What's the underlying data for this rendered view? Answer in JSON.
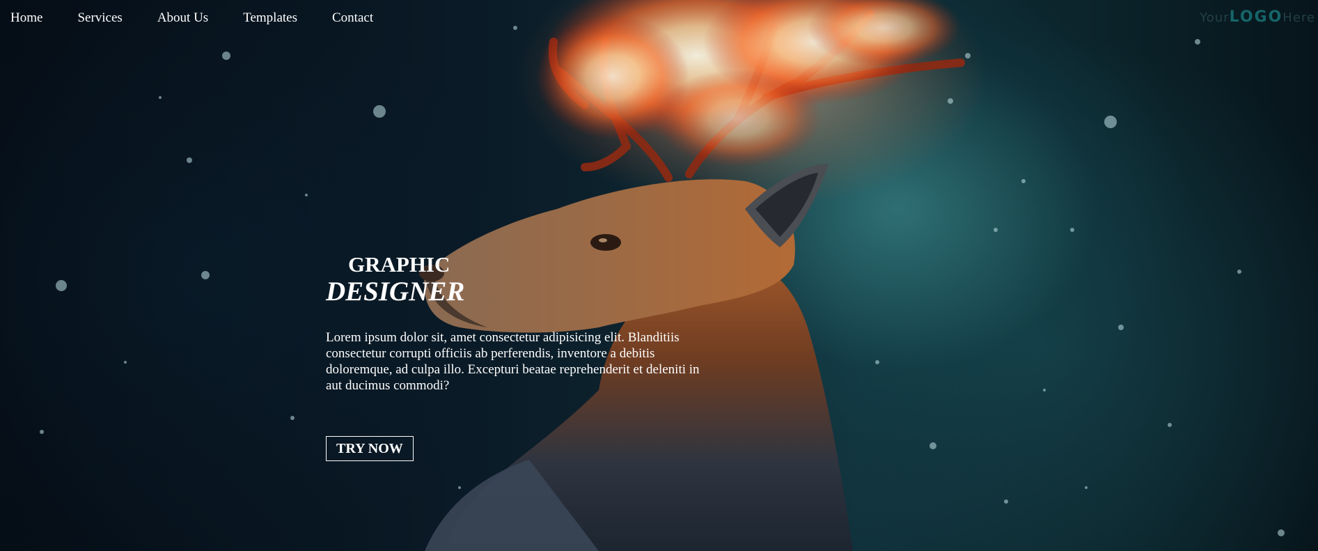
{
  "nav": {
    "items": [
      {
        "label": "Home"
      },
      {
        "label": "Services"
      },
      {
        "label": "About Us"
      },
      {
        "label": "Templates"
      },
      {
        "label": "Contact"
      }
    ]
  },
  "logo": {
    "part1": "Your",
    "part2": "LOGO",
    "part3": "Here"
  },
  "hero": {
    "title_top": "GRAPHIC",
    "title_bottom": "DESIGNER",
    "description": "Lorem ipsum dolor sit, amet consectetur adipisicing elit. Blanditiis consectetur corrupti officiis ab perferendis, inventore a debitis doloremque, ad culpa illo. Excepturi beatae reprehenderit et deleniti in aut ducimus commodi?",
    "cta_label": "TRY NOW"
  },
  "theme": {
    "text_color": "#ffffff",
    "background_dark": "#06101a",
    "background_teal": "#1f5a62",
    "fire_orange": "#ff7a2a"
  }
}
